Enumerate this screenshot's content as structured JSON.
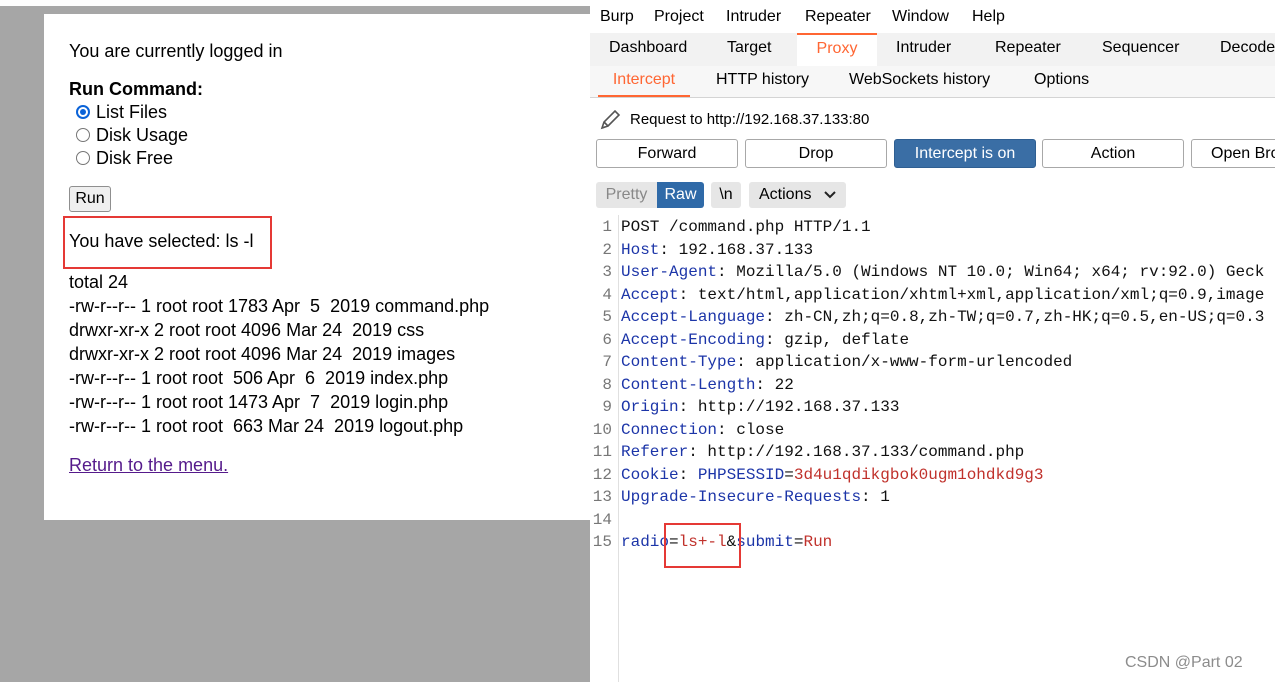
{
  "web": {
    "logged_in_text": "You are currently logged in",
    "run_command_title": "Run Command:",
    "options": [
      "List Files",
      "Disk Usage",
      "Disk Free"
    ],
    "selected_option": "List Files",
    "run_button": "Run",
    "selected_text": "You have selected: ls -l",
    "listing": [
      "total 24",
      "-rw-r--r-- 1 root root 1783 Apr  5  2019 command.php",
      "drwxr-xr-x 2 root root 4096 Mar 24  2019 css",
      "drwxr-xr-x 2 root root 4096 Mar 24  2019 images",
      "-rw-r--r-- 1 root root  506 Apr  6  2019 index.php",
      "-rw-r--r-- 1 root root 1473 Apr  7  2019 login.php",
      "-rw-r--r-- 1 root root  663 Mar 24  2019 logout.php"
    ],
    "return_link": "Return to the menu."
  },
  "burp": {
    "menu": [
      "Burp",
      "Project",
      "Intruder",
      "Repeater",
      "Window",
      "Help"
    ],
    "main_tabs": [
      "Dashboard",
      "Target",
      "Proxy",
      "Intruder",
      "Repeater",
      "Sequencer",
      "Decoder"
    ],
    "active_main_tab": "Proxy",
    "sub_tabs": [
      "Intercept",
      "HTTP history",
      "WebSockets history",
      "Options"
    ],
    "active_sub_tab": "Intercept",
    "request_to": "Request to http://192.168.37.133:80",
    "toolbar": {
      "forward": "Forward",
      "drop": "Drop",
      "intercept": "Intercept is on",
      "action": "Action",
      "open_browser": "Open Browser"
    },
    "format": {
      "pretty": "Pretty",
      "raw": "Raw",
      "newline": "\\n",
      "actions": "Actions"
    },
    "request_lines": [
      {
        "n": "1",
        "plain": "POST /command.php HTTP/1.1"
      },
      {
        "n": "2",
        "key": "Host",
        "value": " 192.168.37.133"
      },
      {
        "n": "3",
        "key": "User-Agent",
        "value": " Mozilla/5.0 (Windows NT 10.0; Win64; x64; rv:92.0) Geck"
      },
      {
        "n": "4",
        "key": "Accept",
        "value": " text/html,application/xhtml+xml,application/xml;q=0.9,image"
      },
      {
        "n": "5",
        "key": "Accept-Language",
        "value": " zh-CN,zh;q=0.8,zh-TW;q=0.7,zh-HK;q=0.5,en-US;q=0.3"
      },
      {
        "n": "6",
        "key": "Accept-Encoding",
        "value": " gzip, deflate"
      },
      {
        "n": "7",
        "key": "Content-Type",
        "value": " application/x-www-form-urlencoded"
      },
      {
        "n": "8",
        "key": "Content-Length",
        "value": " 22"
      },
      {
        "n": "9",
        "key": "Origin",
        "value": " http://192.168.37.133"
      },
      {
        "n": "10",
        "key": "Connection",
        "value": " close"
      },
      {
        "n": "11",
        "key": "Referer",
        "value": " http://192.168.37.133/command.php"
      },
      {
        "n": "12",
        "key": "Cookie",
        "value": " ",
        "ckey": "PHPSESSID",
        "cval": "3d4u1qdikgbok0ugm1ohdkd9g3"
      },
      {
        "n": "13",
        "key": "Upgrade-Insecure-Requests",
        "value": " 1"
      },
      {
        "n": "14",
        "plain": ""
      },
      {
        "n": "15",
        "body": [
          {
            "t": "radio",
            "c": "hk"
          },
          {
            "t": "=",
            "c": "hv"
          },
          {
            "t": "ls+-l",
            "c": "pv"
          },
          {
            "t": "&",
            "c": "hv"
          },
          {
            "t": "submit",
            "c": "hk"
          },
          {
            "t": "=",
            "c": "hv"
          },
          {
            "t": "Run",
            "c": "pv"
          }
        ]
      }
    ]
  },
  "watermark": "CSDN @Part 02",
  "colors": {
    "burp_accent": "#ff6633",
    "intercept_on": "#3a6ea5",
    "highlight_box": "#e53935",
    "header_key": "#1c35a8",
    "param_value": "#c0312b"
  }
}
